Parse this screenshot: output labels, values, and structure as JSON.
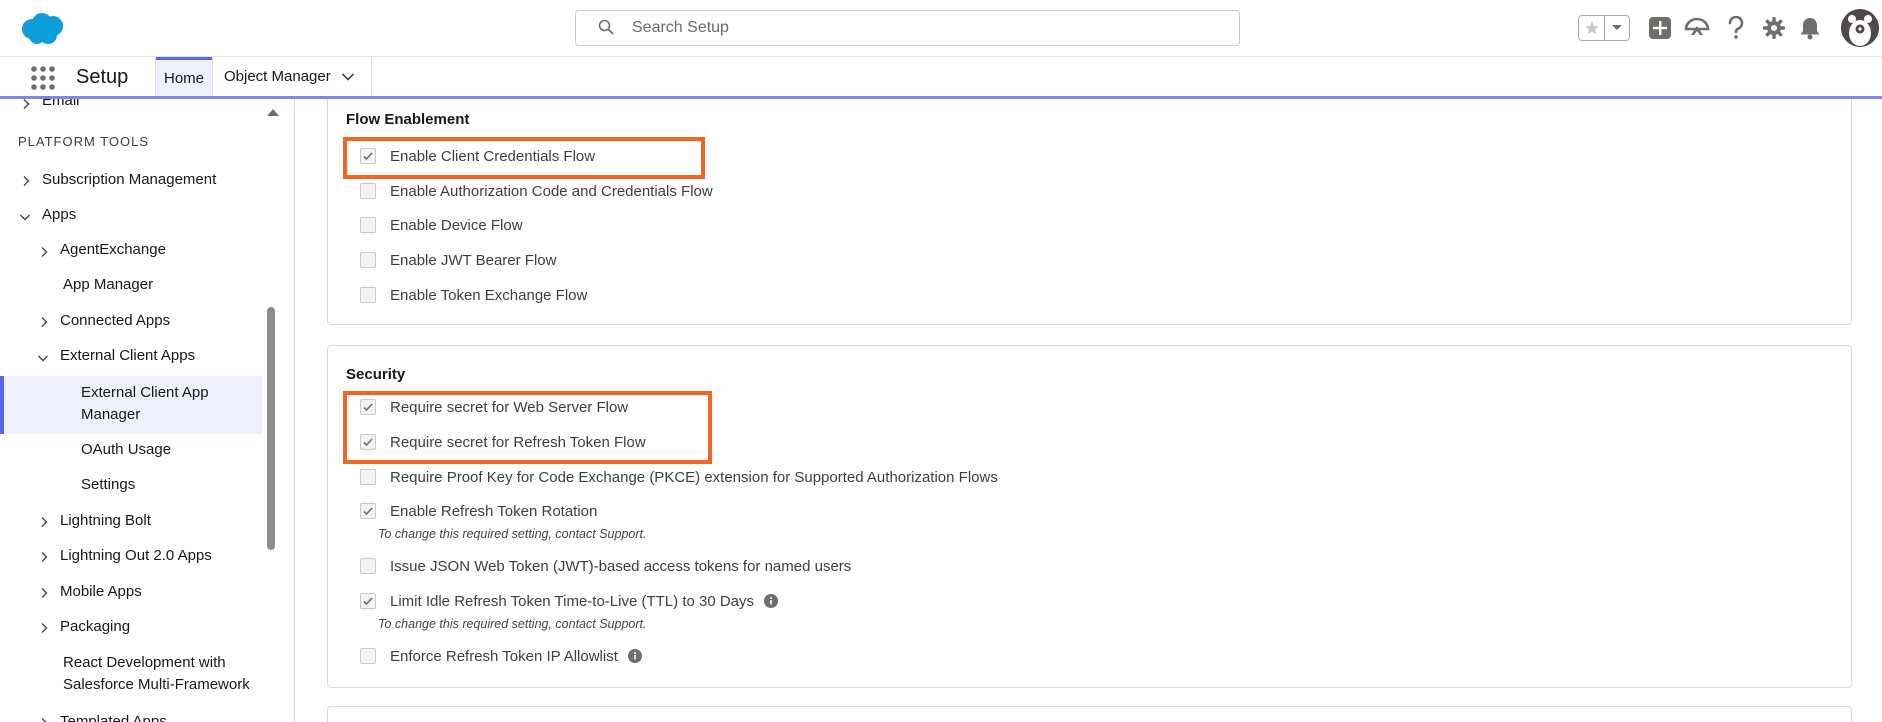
{
  "header": {
    "search_placeholder": "Search Setup"
  },
  "nav": {
    "app_name": "Setup",
    "tabs": [
      {
        "label": "Home"
      },
      {
        "label": "Object Manager"
      }
    ]
  },
  "sidebar": {
    "email": "Email",
    "platform_tools": "PLATFORM TOOLS",
    "items": [
      {
        "label": "Subscription Management"
      },
      {
        "label": "Apps"
      },
      {
        "label": "AgentExchange"
      },
      {
        "label": "App Manager"
      },
      {
        "label": "Connected Apps"
      },
      {
        "label": "External Client Apps"
      },
      {
        "label": "External Client App"
      },
      {
        "label": "Manager"
      },
      {
        "label": "OAuth Usage"
      },
      {
        "label": "Settings"
      },
      {
        "label": "Lightning Bolt"
      },
      {
        "label": "Lightning Out 2.0 Apps"
      },
      {
        "label": "Mobile Apps"
      },
      {
        "label": "Packaging"
      },
      {
        "label": "React Development with"
      },
      {
        "label": "Salesforce Multi-Framework"
      },
      {
        "label": "Templated Apps"
      }
    ]
  },
  "flow": {
    "title": "Flow Enablement",
    "items": [
      {
        "label": "Enable Client Credentials Flow",
        "checked": true
      },
      {
        "label": "Enable Authorization Code and Credentials Flow",
        "checked": false
      },
      {
        "label": "Enable Device Flow",
        "checked": false
      },
      {
        "label": "Enable JWT Bearer Flow",
        "checked": false
      },
      {
        "label": "Enable Token Exchange Flow",
        "checked": false
      }
    ]
  },
  "security": {
    "title": "Security",
    "items": [
      {
        "label": "Require secret for Web Server Flow",
        "checked": true
      },
      {
        "label": "Require secret for Refresh Token Flow",
        "checked": true
      },
      {
        "label": "Require Proof Key for Code Exchange (PKCE) extension for Supported Authorization Flows",
        "checked": false
      },
      {
        "label": "Enable Refresh Token Rotation",
        "checked": true
      },
      {
        "label": "Issue JSON Web Token (JWT)-based access tokens for named users",
        "checked": false
      },
      {
        "label": "Limit Idle Refresh Token Time-to-Live (TTL) to 30 Days",
        "checked": true
      },
      {
        "label": "Enforce Refresh Token IP Allowlist",
        "checked": false
      }
    ],
    "note": "To change this required setting, contact Support."
  },
  "colors": {
    "accent": "#5867e8",
    "highlight": "#f26522",
    "brand": "#0d9dda"
  }
}
